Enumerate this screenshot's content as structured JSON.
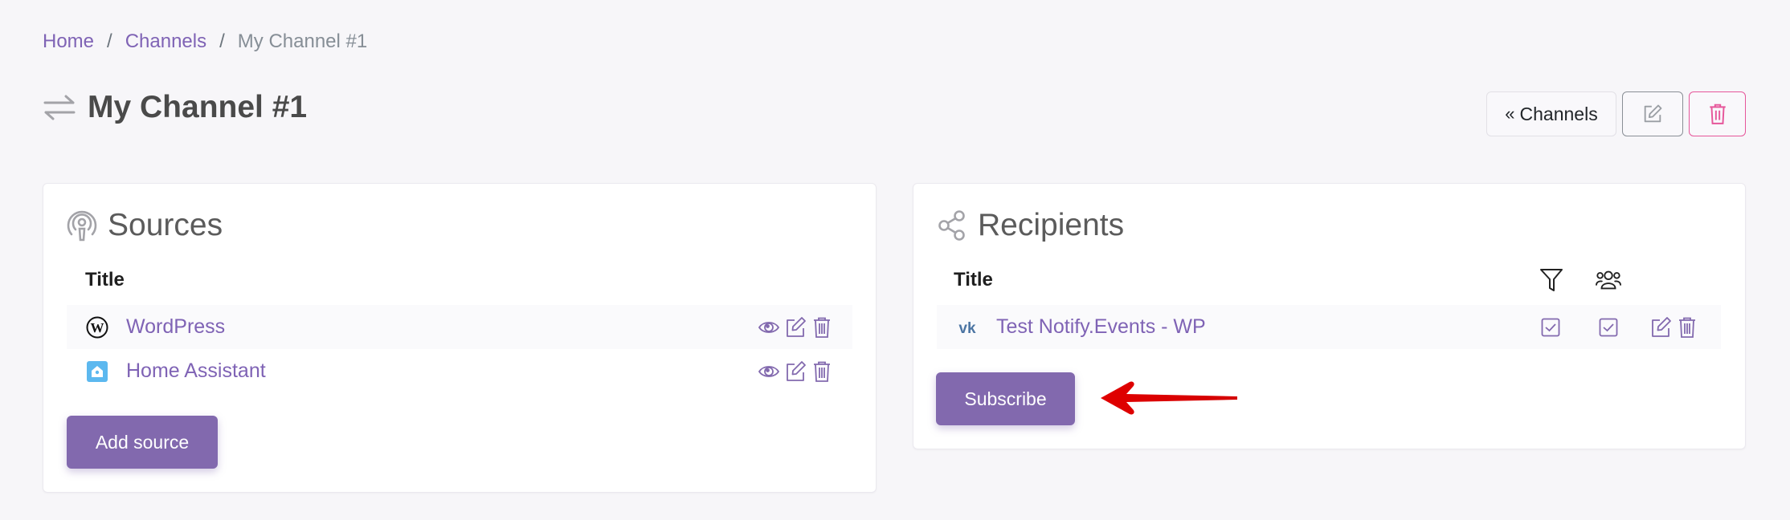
{
  "breadcrumb": {
    "items": [
      {
        "label": "Home"
      },
      {
        "label": "Channels"
      }
    ],
    "separator": "/",
    "current": "My Channel #1"
  },
  "header": {
    "icon": "arrows-exchange-icon",
    "title": "My Channel #1",
    "actions": {
      "back_label": "Channels",
      "back_icon": "double-chevron-left-icon",
      "edit_icon": "edit-icon",
      "delete_icon": "trash-icon"
    }
  },
  "sources": {
    "title": "Sources",
    "icon": "broadcast-icon",
    "column_title": "Title",
    "rows": [
      {
        "name": "WordPress",
        "icon": "wordpress-icon",
        "actions": [
          "view",
          "edit",
          "delete"
        ]
      },
      {
        "name": "Home Assistant",
        "icon": "home-assistant-icon",
        "actions": [
          "view",
          "edit",
          "delete"
        ]
      }
    ],
    "add_button": "Add source"
  },
  "recipients": {
    "title": "Recipients",
    "icon": "share-icon",
    "column_title": "Title",
    "column_icons": [
      "filter-icon",
      "users-icon"
    ],
    "rows": [
      {
        "name": "Test Notify.Events - WP",
        "icon": "vk-icon",
        "filter": true,
        "group": true,
        "actions": [
          "edit",
          "delete"
        ]
      }
    ],
    "subscribe_button": "Subscribe"
  },
  "colors": {
    "accent": "#8269ae",
    "link": "#7f63b5",
    "danger": "#e6569a",
    "annotation_arrow": "#e00000"
  }
}
